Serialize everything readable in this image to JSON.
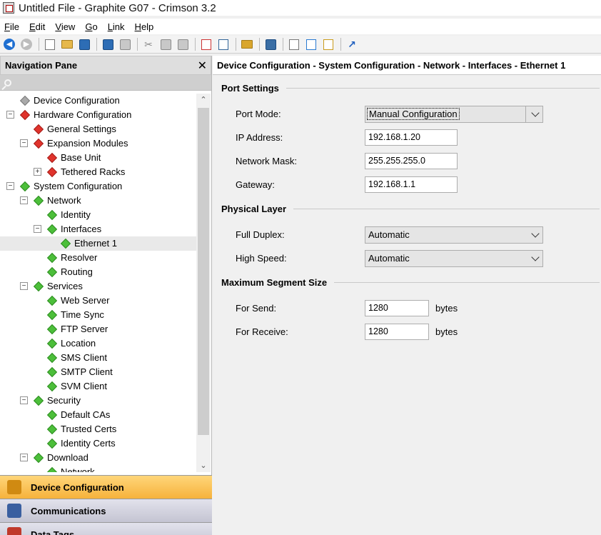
{
  "window": {
    "title": "Untitled File - Graphite G07 - Crimson 3.2"
  },
  "menu": [
    {
      "label": "File",
      "key": "F",
      "rest": "ile"
    },
    {
      "label": "Edit",
      "key": "E",
      "rest": "dit"
    },
    {
      "label": "View",
      "key": "V",
      "rest": "iew"
    },
    {
      "label": "Go",
      "key": "G",
      "rest": "o"
    },
    {
      "label": "Link",
      "key": "L",
      "rest": "ink"
    },
    {
      "label": "Help",
      "key": "H",
      "rest": "elp"
    }
  ],
  "toolbar": {
    "icons": [
      "back-icon",
      "forward-icon",
      "new-file-icon",
      "open-folder-icon",
      "save-icon",
      "undo-icon",
      "redo-icon",
      "cut-icon",
      "copy-icon",
      "paste-icon",
      "find-icon",
      "replace-icon",
      "handshake-icon",
      "monitor-icon",
      "search-doc-icon",
      "web-doc-icon",
      "lock-doc-icon",
      "link-icon"
    ]
  },
  "nav": {
    "title": "Navigation Pane",
    "close": "✕",
    "tree": [
      {
        "label": "Device Configuration",
        "level": 0,
        "color": "gray",
        "expander": ""
      },
      {
        "label": "Hardware Configuration",
        "level": 0,
        "color": "red",
        "expander": "−"
      },
      {
        "label": "General Settings",
        "level": 1,
        "color": "red",
        "expander": ""
      },
      {
        "label": "Expansion Modules",
        "level": 1,
        "color": "red",
        "expander": "−"
      },
      {
        "label": "Base Unit",
        "level": 2,
        "color": "red",
        "expander": ""
      },
      {
        "label": "Tethered Racks",
        "level": 2,
        "color": "red",
        "expander": "+"
      },
      {
        "label": "System Configuration",
        "level": 0,
        "color": "green",
        "expander": "−"
      },
      {
        "label": "Network",
        "level": 1,
        "color": "green",
        "expander": "−"
      },
      {
        "label": "Identity",
        "level": 2,
        "color": "green",
        "expander": ""
      },
      {
        "label": "Interfaces",
        "level": 2,
        "color": "green",
        "expander": "−"
      },
      {
        "label": "Ethernet 1",
        "level": 3,
        "color": "green",
        "expander": "",
        "selected": true
      },
      {
        "label": "Resolver",
        "level": 2,
        "color": "green",
        "expander": ""
      },
      {
        "label": "Routing",
        "level": 2,
        "color": "green",
        "expander": ""
      },
      {
        "label": "Services",
        "level": 1,
        "color": "green",
        "expander": "−"
      },
      {
        "label": "Web Server",
        "level": 2,
        "color": "green",
        "expander": ""
      },
      {
        "label": "Time Sync",
        "level": 2,
        "color": "green",
        "expander": ""
      },
      {
        "label": "FTP Server",
        "level": 2,
        "color": "green",
        "expander": ""
      },
      {
        "label": "Location",
        "level": 2,
        "color": "green",
        "expander": ""
      },
      {
        "label": "SMS Client",
        "level": 2,
        "color": "green",
        "expander": ""
      },
      {
        "label": "SMTP Client",
        "level": 2,
        "color": "green",
        "expander": ""
      },
      {
        "label": "SVM Client",
        "level": 2,
        "color": "green",
        "expander": ""
      },
      {
        "label": "Security",
        "level": 1,
        "color": "green",
        "expander": "−"
      },
      {
        "label": "Default CAs",
        "level": 2,
        "color": "green",
        "expander": ""
      },
      {
        "label": "Trusted Certs",
        "level": 2,
        "color": "green",
        "expander": ""
      },
      {
        "label": "Identity Certs",
        "level": 2,
        "color": "green",
        "expander": ""
      },
      {
        "label": "Download",
        "level": 1,
        "color": "green",
        "expander": "−"
      },
      {
        "label": "Network",
        "level": 2,
        "color": "green",
        "expander": ""
      }
    ],
    "buttons": [
      {
        "label": "Device Configuration",
        "active": true,
        "icon": "gears-icon"
      },
      {
        "label": "Communications",
        "active": false,
        "icon": "computer-network-icon"
      },
      {
        "label": "Data Tags",
        "active": false,
        "icon": "tags-icon"
      }
    ]
  },
  "content": {
    "breadcrumb": "Device Configuration - System Configuration - Network - Interfaces - Ethernet 1",
    "sections": {
      "port_settings": "Port Settings",
      "physical_layer": "Physical Layer",
      "mss": "Maximum Segment Size"
    },
    "fields": {
      "port_mode": {
        "label": "Port Mode:",
        "value": "Manual Configuration"
      },
      "ip_address": {
        "label": "IP Address:",
        "value": "192.168.1.20"
      },
      "network_mask": {
        "label": "Network Mask:",
        "value": "255.255.255.0"
      },
      "gateway": {
        "label": "Gateway:",
        "value": "192.168.1.1"
      },
      "full_duplex": {
        "label": "Full Duplex:",
        "value": "Automatic"
      },
      "high_speed": {
        "label": "High Speed:",
        "value": "Automatic"
      },
      "for_send": {
        "label": "For Send:",
        "value": "1280",
        "unit": "bytes"
      },
      "for_receive": {
        "label": "For Receive:",
        "value": "1280",
        "unit": "bytes"
      }
    }
  }
}
